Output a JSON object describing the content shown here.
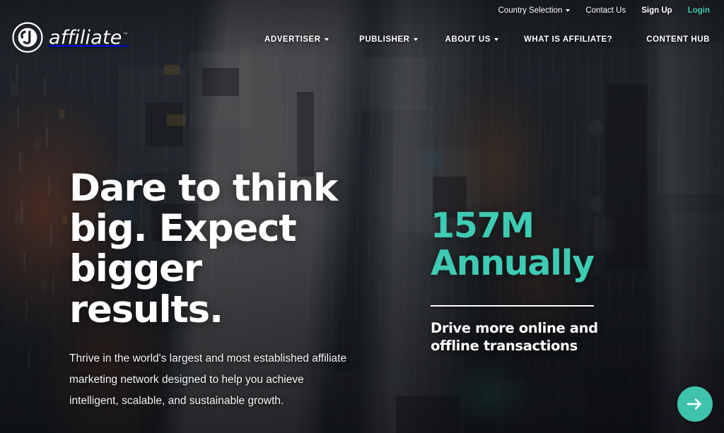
{
  "site": {
    "brand_name": "affiliate",
    "brand_mark": "cj-circle-logo",
    "trademark": "™"
  },
  "colors": {
    "accent_teal": "#3ECBB4",
    "button_teal": "#3FC3AC",
    "text_white": "#FFFFFF",
    "overlay_dark": "#15171B"
  },
  "utility_nav": {
    "items": [
      {
        "label": "Country Selection",
        "has_caret": true,
        "style": "plain"
      },
      {
        "label": "Contact Us",
        "has_caret": false,
        "style": "plain"
      },
      {
        "label": "Sign Up",
        "has_caret": false,
        "style": "bold"
      },
      {
        "label": "Login",
        "has_caret": false,
        "style": "teal"
      }
    ]
  },
  "main_nav": {
    "items": [
      {
        "label": "ADVERTISER",
        "has_caret": true
      },
      {
        "label": "PUBLISHER",
        "has_caret": true
      },
      {
        "label": "ABOUT US",
        "has_caret": true
      },
      {
        "label": "WHAT IS AFFILIATE?",
        "has_caret": false
      },
      {
        "label": "CONTENT HUB",
        "has_caret": false
      }
    ]
  },
  "hero": {
    "headline_line1": "Dare to think",
    "headline_line2": "big. Expect",
    "headline_line3": "bigger results.",
    "subcopy": "Thrive in the world's largest and most established affiliate marketing network designed to help you achieve intelligent, scalable, and sustainable growth.",
    "stat_value_line1": "157M",
    "stat_value_line2": "Annually",
    "stat_caption_line1": "Drive more online and",
    "stat_caption_line2": "offline transactions",
    "background_description": "aerial-city-street-photo"
  },
  "next_button": {
    "icon": "arrow-right-icon",
    "label": "Next slide"
  }
}
